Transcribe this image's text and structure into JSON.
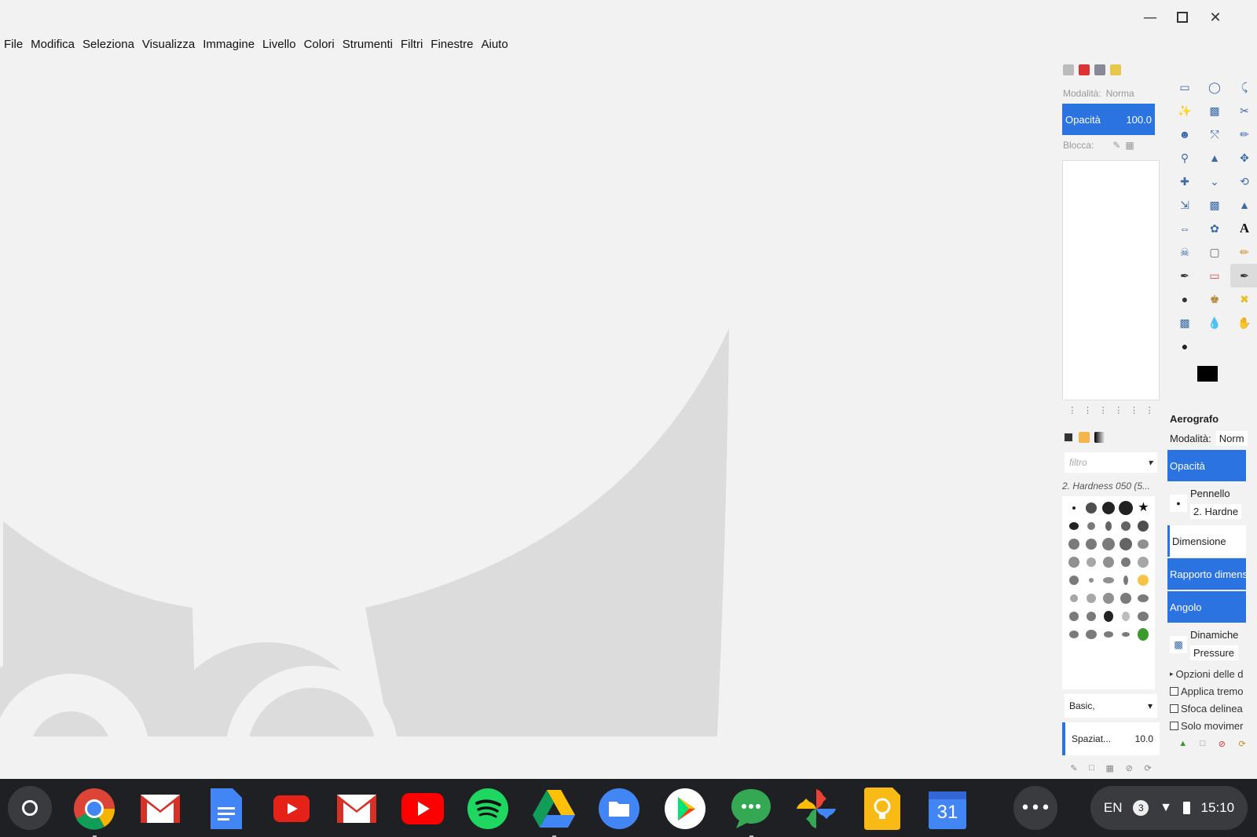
{
  "window": {
    "menu": [
      "File",
      "Modifica",
      "Seleziona",
      "Visualizza",
      "Immagine",
      "Livello",
      "Colori",
      "Strumenti",
      "Filtri",
      "Finestre",
      "Aiuto"
    ],
    "minimize_icon": "minimize-icon",
    "maximize_icon": "maximize-icon",
    "close_icon": "close-icon"
  },
  "layers_dock": {
    "mode_label": "Modalità:",
    "mode_value": "Norma",
    "opacity_label": "Opacità",
    "opacity_value": "100.0",
    "lock_label": "Blocca:"
  },
  "brushes_dock": {
    "filter_placeholder": "filtro",
    "selected_brush": "2. Hardness 050 (5...",
    "tag_value": "Basic,",
    "spacing_label": "Spaziat...",
    "spacing_value": "10.0"
  },
  "tool_options": {
    "title": "Aerografo",
    "mode_label": "Modalità:",
    "mode_value": "Norm",
    "opacity_label": "Opacità",
    "brush_label": "Pennello",
    "brush_value": "2. Hardne",
    "size_label": "Dimensione",
    "ratio_label": "Rapporto dimens",
    "angle_label": "Angolo",
    "dynamics_label": "Dinamiche",
    "dynamics_value": "Pressure",
    "dynamics_options": "Opzioni delle d",
    "apply_jitter": "Applica tremo",
    "smooth_stroke": "Sfoca delinea",
    "motion_only": "Solo movimer"
  },
  "colors": {
    "accent": "#2b73e0",
    "foreground": "#000000",
    "background": "#ffffff",
    "shelf": "#1f2023"
  },
  "shelf": {
    "apps": [
      "chrome",
      "gmail",
      "docs",
      "youtube",
      "gmail",
      "youtube",
      "spotify",
      "drive",
      "files",
      "play-store",
      "messages",
      "photos",
      "keep",
      "calendar"
    ],
    "calendar_day": "31",
    "more_icon": "•••",
    "language": "EN",
    "notification_count": "3",
    "time": "15:10"
  }
}
